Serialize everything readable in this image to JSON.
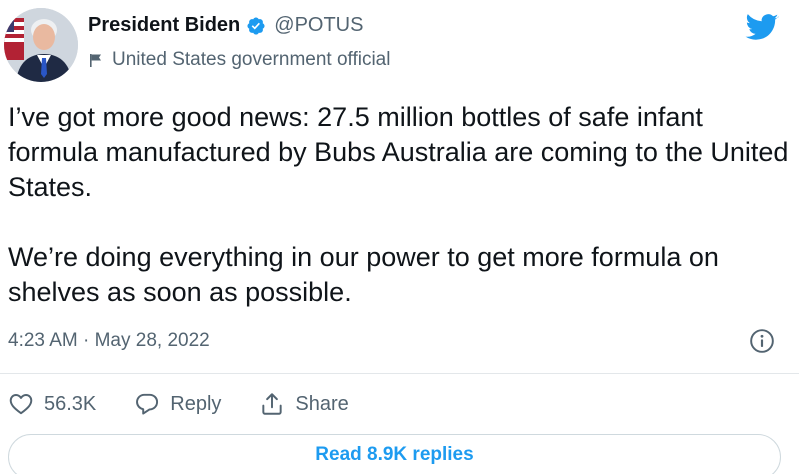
{
  "author": {
    "display_name": "President Biden",
    "handle": "@POTUS",
    "label": "United States government official"
  },
  "icons": {
    "verified": "verified-badge-icon",
    "label_flag": "flag-icon",
    "brand": "twitter-bird-icon",
    "info": "info-icon",
    "like": "heart-icon",
    "reply": "speech-bubble-icon",
    "share": "share-upload-icon"
  },
  "tweet": {
    "paragraphs": [
      "I’ve got more good news: 27.5 million bottles of safe infant formula manufactured by Bubs Australia are coming to the United States.",
      "We’re doing everything in our power to get more formula on shelves as soon as possible."
    ],
    "timestamp": "4:23 AM · May 28, 2022"
  },
  "actions": {
    "like_count": "56.3K",
    "reply_label": "Reply",
    "share_label": "Share"
  },
  "read_replies_label": "Read 8.9K replies",
  "colors": {
    "brand_blue": "#1d9bf0",
    "text_primary": "#0f1419",
    "text_secondary": "#536471",
    "border": "#cfd9de"
  }
}
